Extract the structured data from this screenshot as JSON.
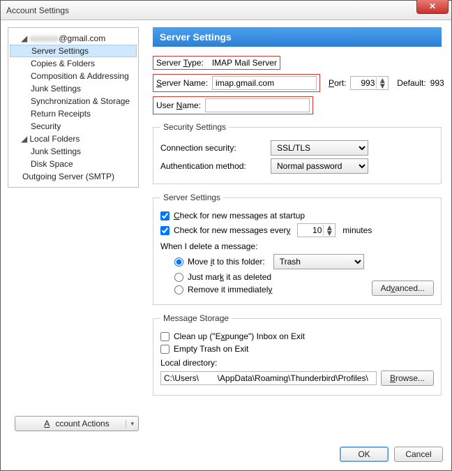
{
  "window": {
    "title": "Account Settings",
    "close_glyph": "✕"
  },
  "sidebar": {
    "account_email_suffix": "@gmail.com",
    "items_account": [
      "Server Settings",
      "Copies & Folders",
      "Composition & Addressing",
      "Junk Settings",
      "Synchronization & Storage",
      "Return Receipts",
      "Security"
    ],
    "local_folders_label": "Local Folders",
    "items_local": [
      "Junk Settings",
      "Disk Space"
    ],
    "outgoing_label": "Outgoing Server (SMTP)",
    "account_actions_label": "Account Actions"
  },
  "panel": {
    "header": "Server Settings",
    "server_type_label_pre": "Server ",
    "server_type_label_u": "T",
    "server_type_label_post": "ype:",
    "server_type_value": "IMAP Mail Server",
    "server_name_label_pre": "",
    "server_name_label_u": "S",
    "server_name_label_post": "erver Name:",
    "server_name_value": "imap.gmail.com",
    "port_label_pre": "",
    "port_label_u": "P",
    "port_label_post": "ort:",
    "port_value": "993",
    "default_label": "Default:",
    "default_value": "993",
    "user_name_label_pre": "User ",
    "user_name_label_u": "N",
    "user_name_label_post": "ame:",
    "user_name_value": ""
  },
  "security": {
    "legend": "Security Settings",
    "conn_label": "Connection security:",
    "conn_value": "SSL/TLS",
    "auth_label": "Authentication method:",
    "auth_value": "Normal password"
  },
  "server": {
    "legend": "Server Settings",
    "check_startup_pre": "",
    "check_startup_u": "C",
    "check_startup_post": "heck for new messages at startup",
    "check_every_pre": "Check for new messages ever",
    "check_every_u": "y",
    "check_every_post": "",
    "check_every_value": "10",
    "minutes": "minutes",
    "when_delete": "When I delete a message:",
    "opt_move_pre": "Move ",
    "opt_move_u": "i",
    "opt_move_post": "t to this folder:",
    "opt_move_folder": "Trash",
    "opt_mark_pre": "Just mar",
    "opt_mark_u": "k",
    "opt_mark_post": " it as deleted",
    "opt_remove_pre": "Remove it immediatel",
    "opt_remove_u": "y",
    "opt_remove_post": "",
    "advanced_pre": "Ad",
    "advanced_u": "v",
    "advanced_post": "anced..."
  },
  "storage": {
    "legend": "Message Storage",
    "expunge_pre": "Clean up (\"E",
    "expunge_u": "x",
    "expunge_post": "punge\") Inbox on Exit",
    "empty_trash": "Empty Trash on Exit",
    "local_dir_label": "Local directory:",
    "local_dir_value": "C:\\Users\\        \\AppData\\Roaming\\Thunderbird\\Profiles\\",
    "browse_pre": "",
    "browse_u": "B",
    "browse_post": "rowse..."
  },
  "footer": {
    "ok": "OK",
    "cancel": "Cancel"
  }
}
